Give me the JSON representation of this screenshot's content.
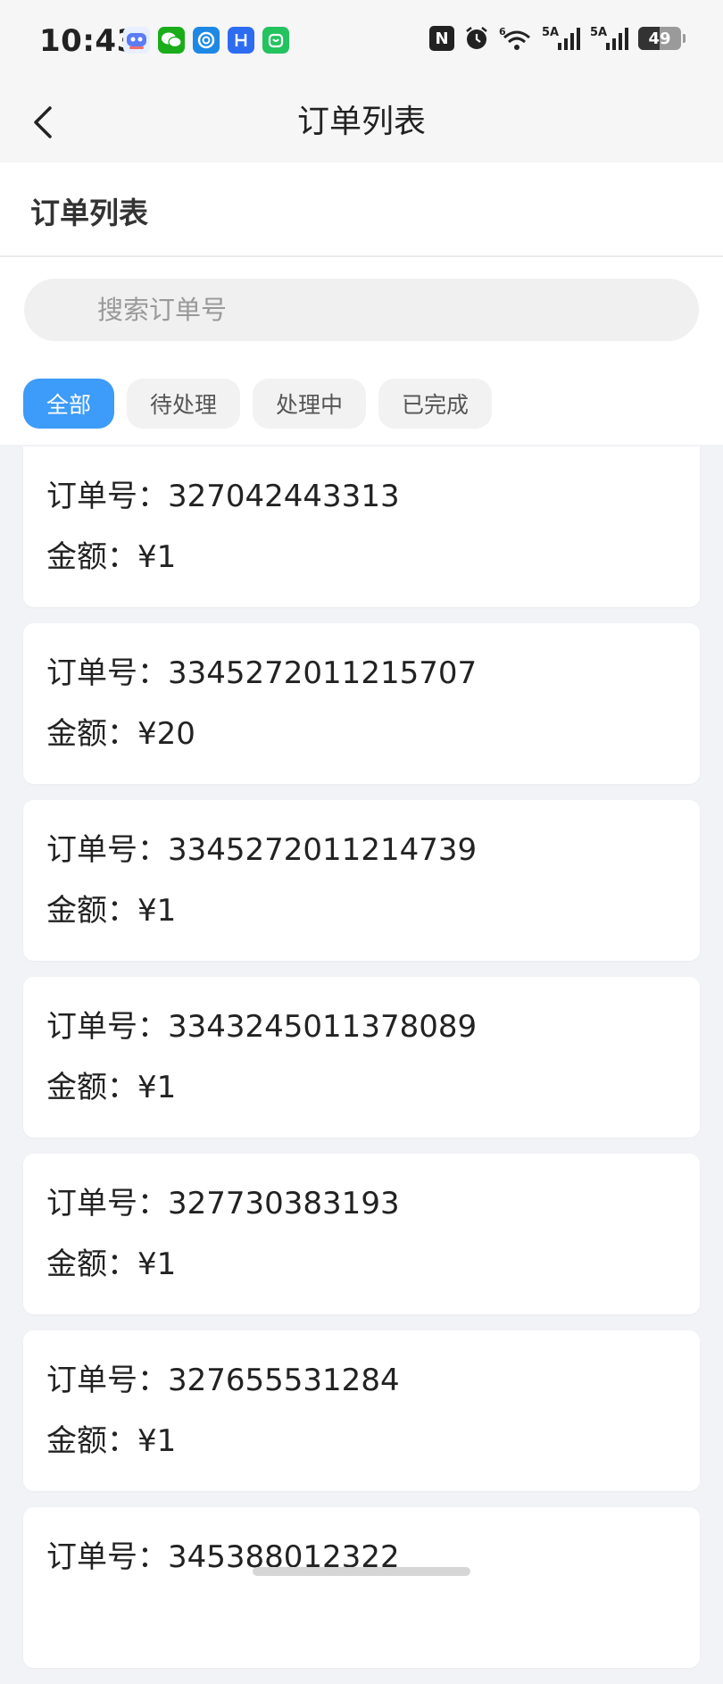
{
  "status_bar": {
    "time": "10:43",
    "network_1": "5A",
    "network_2": "5A",
    "wifi_label": "6",
    "battery_level": "49",
    "battery_fraction": 0.49
  },
  "nav": {
    "title": "订单列表"
  },
  "section": {
    "title": "订单列表"
  },
  "search": {
    "placeholder": "搜索订单号",
    "value": ""
  },
  "tabs": [
    {
      "label": "全部",
      "active": true
    },
    {
      "label": "待处理",
      "active": false
    },
    {
      "label": "处理中",
      "active": false
    },
    {
      "label": "已完成",
      "active": false
    }
  ],
  "orders": [
    {
      "order_label": "订单号：",
      "order_no": "327042443313",
      "amount_label": "金额：",
      "amount": "¥1"
    },
    {
      "order_label": "订单号：",
      "order_no": "3345272011215707",
      "amount_label": "金额：",
      "amount": "¥20"
    },
    {
      "order_label": "订单号：",
      "order_no": "3345272011214739",
      "amount_label": "金额：",
      "amount": "¥1"
    },
    {
      "order_label": "订单号：",
      "order_no": "3343245011378089",
      "amount_label": "金额：",
      "amount": "¥1"
    },
    {
      "order_label": "订单号：",
      "order_no": "327730383193",
      "amount_label": "金额：",
      "amount": "¥1"
    },
    {
      "order_label": "订单号：",
      "order_no": "327655531284",
      "amount_label": "金额：",
      "amount": "¥1"
    },
    {
      "order_label": "订单号：",
      "order_no": "345388012322",
      "amount_label": "",
      "amount": ""
    }
  ],
  "colors": {
    "accent": "#3d9bf9",
    "page_bg": "#f2f3f6"
  },
  "icons": {
    "back": "chevron-left-icon",
    "search": "search-icon"
  }
}
